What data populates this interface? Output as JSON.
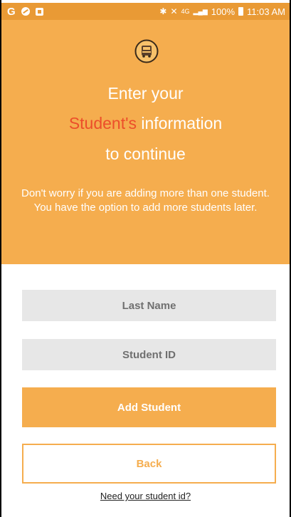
{
  "status_bar": {
    "left_icons": [
      "g-icon",
      "blocked-circle-icon",
      "notification-square-icon"
    ],
    "g_glyph": "G",
    "bluetooth_glyph": "✱",
    "mute_glyph": "✕",
    "network": "4G",
    "signal_glyph": "▂▄▆",
    "battery": "100%",
    "time": "11:03 AM"
  },
  "header": {
    "title_line1": "Enter your",
    "title_highlight": "Student's",
    "title_line2_rest": "information",
    "title_line3": "to continue",
    "hint": "Don't worry if you are adding more than one student. You have the option to add more students later."
  },
  "form": {
    "last_name_placeholder": "Last Name",
    "student_id_placeholder": "Student ID",
    "add_button": "Add Student",
    "back_button": "Back",
    "help_link": "Need your student id?"
  },
  "colors": {
    "status_bar": "#e99a35",
    "header_bg": "#f5ad4e",
    "highlight": "#ec4e2a",
    "field_bg": "#e7e7e7"
  }
}
